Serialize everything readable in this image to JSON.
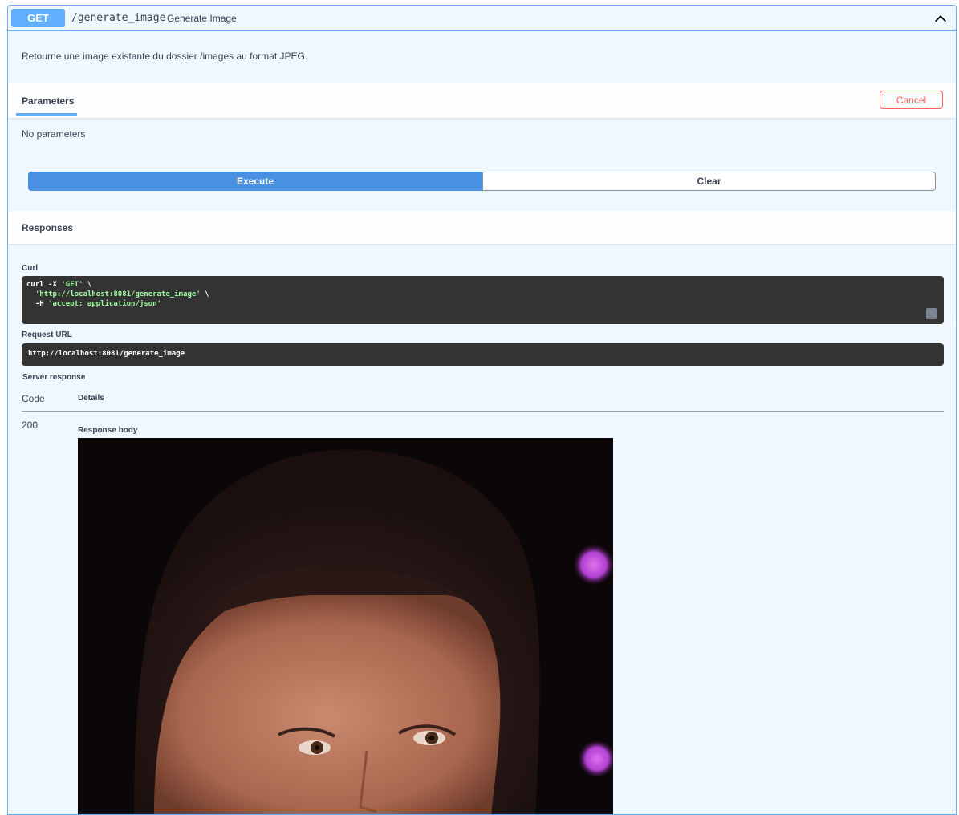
{
  "endpoint": {
    "method": "GET",
    "path": "/generate_image",
    "summary": "Generate Image",
    "description": "Retourne une image existante du dossier /images au format JPEG."
  },
  "parameters": {
    "tab_label": "Parameters",
    "cancel_label": "Cancel",
    "empty_text": "No parameters"
  },
  "actions": {
    "execute_label": "Execute",
    "clear_label": "Clear"
  },
  "responses": {
    "title": "Responses",
    "curl_label": "Curl",
    "curl_line1_cmd": "curl -X ",
    "curl_line1_method": "'GET'",
    "curl_line1_tail": " \\",
    "curl_line2_url": "'http://localhost:8081/generate_image'",
    "curl_line2_tail": " \\",
    "curl_line3_flag": "  -H ",
    "curl_line3_header": "'accept: application/json'",
    "request_url_label": "Request URL",
    "request_url": "http://localhost:8081/generate_image",
    "server_response_label": "Server response",
    "col_code": "Code",
    "col_details": "Details",
    "status_code": "200",
    "response_body_label": "Response body"
  },
  "colors": {
    "get_accent": "#61affe",
    "execute_blue": "#4990e2",
    "cancel_red": "#ff6060",
    "code_bg": "#333333"
  },
  "icons": [
    "chevron-up-icon",
    "copy-icon"
  ]
}
